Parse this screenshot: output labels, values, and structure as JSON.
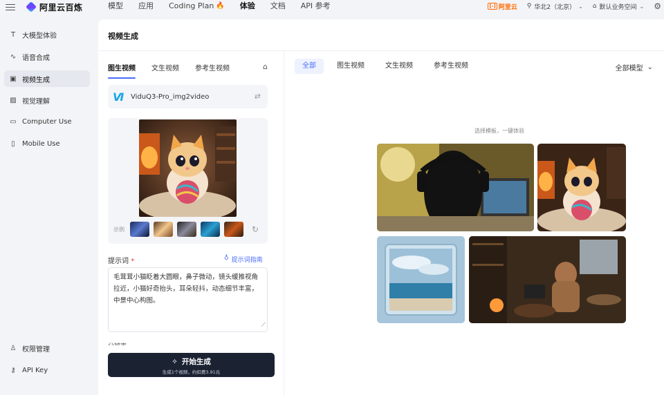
{
  "brand": {
    "name": "阿里云百炼"
  },
  "nav": [
    {
      "label": "模型",
      "active": false
    },
    {
      "label": "应用",
      "active": false
    },
    {
      "label": "Coding Plan",
      "active": false,
      "badge": "flame"
    },
    {
      "label": "体验",
      "active": true
    },
    {
      "label": "文档",
      "active": false
    },
    {
      "label": "API 参考",
      "active": false
    }
  ],
  "topright": {
    "aliyun": "阿里云",
    "region": "华北2（北京）",
    "workspace": "默认业务空间"
  },
  "sidebar": {
    "items": [
      {
        "label": "大模型体验",
        "icon": "text-icon"
      },
      {
        "label": "语音合成",
        "icon": "waveform-icon"
      },
      {
        "label": "视频生成",
        "icon": "video-icon",
        "active": true
      },
      {
        "label": "视觉理解",
        "icon": "image-icon"
      },
      {
        "label": "Computer Use",
        "icon": "monitor-icon"
      },
      {
        "label": "Mobile Use",
        "icon": "mobile-icon"
      }
    ],
    "bottom": [
      {
        "label": "权限管理",
        "icon": "user-icon"
      },
      {
        "label": "API Key",
        "icon": "key-icon"
      }
    ]
  },
  "page": {
    "title": "视频生成"
  },
  "left": {
    "tabs": [
      {
        "label": "图生视频",
        "active": true
      },
      {
        "label": "文生视频",
        "active": false
      },
      {
        "label": "参考生视频",
        "active": false
      }
    ],
    "model": "ViduQ3-Pro_img2video",
    "example_label": "示例",
    "prompt_label": "提示词",
    "prompt_required": "*",
    "guide": "提示词指南",
    "prompt_text": "毛茸茸小猫眨着大圆眼，鼻子微动，镜头缓推视角拉近，小猫好奇抬头，耳朵轻抖，动态细节丰富，中景中心构图。",
    "cut_label": "分辨率",
    "generate": "开始生成",
    "generate_sub": "生成1个视频，约扣费3.91元"
  },
  "right": {
    "tabs": [
      {
        "label": "全部",
        "active": true
      },
      {
        "label": "图生视频",
        "active": false
      },
      {
        "label": "文生视频",
        "active": false
      },
      {
        "label": "参考生视频",
        "active": false
      }
    ],
    "filter": "全部模型",
    "hint": "选择模板，一键体验"
  },
  "colors": {
    "accent": "#4a6cf7",
    "button": "#1b2333",
    "aliyun": "#ff6a00"
  }
}
